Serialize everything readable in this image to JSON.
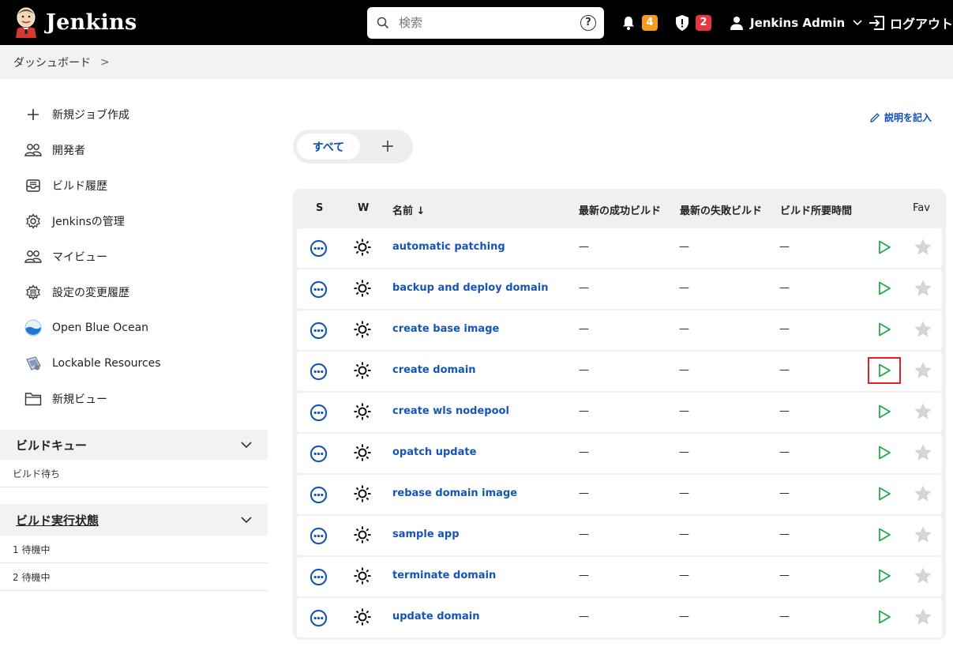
{
  "header": {
    "brand": "Jenkins",
    "search_placeholder": "検索",
    "help": "?",
    "notifications_count": "4",
    "security_count": "2",
    "user_name": "Jenkins Admin",
    "logout": "ログアウト"
  },
  "breadcrumb": {
    "dashboard": "ダッシュボード",
    "separator": ">"
  },
  "sidebar": {
    "items": [
      {
        "label": "新規ジョブ作成",
        "icon": "plus-icon"
      },
      {
        "label": "開発者",
        "icon": "people-icon"
      },
      {
        "label": "ビルド履歴",
        "icon": "inbox-icon"
      },
      {
        "label": "Jenkinsの管理",
        "icon": "gear-icon"
      },
      {
        "label": "マイビュー",
        "icon": "people-icon"
      },
      {
        "label": "設定の変更履歴",
        "icon": "config-history-icon"
      },
      {
        "label": "Open Blue Ocean",
        "icon": "blue-ocean-icon"
      },
      {
        "label": "Lockable Resources",
        "icon": "lock-resources-icon"
      },
      {
        "label": "新規ビュー",
        "icon": "folder-icon"
      }
    ],
    "build_queue": {
      "title": "ビルドキュー",
      "empty": "ビルド待ち"
    },
    "executors": {
      "title": "ビルド実行状態",
      "rows": [
        "1 待機中",
        "2 待機中"
      ]
    }
  },
  "main": {
    "add_description": "説明を記入",
    "tabs": {
      "all": "すべて",
      "add": "+"
    },
    "columns": {
      "s": "S",
      "w": "W",
      "name": "名前 ↓",
      "last_success": "最新の成功ビルド",
      "last_failure": "最新の失敗ビルド",
      "duration": "ビルド所要時間",
      "fav": "Fav"
    },
    "jobs": [
      {
        "name": "automatic patching",
        "last_success": "—",
        "last_failure": "—",
        "duration": "—"
      },
      {
        "name": "backup and deploy domain",
        "last_success": "—",
        "last_failure": "—",
        "duration": "—"
      },
      {
        "name": "create base image",
        "last_success": "—",
        "last_failure": "—",
        "duration": "—"
      },
      {
        "name": "create domain",
        "last_success": "—",
        "last_failure": "—",
        "duration": "—"
      },
      {
        "name": "create wls nodepool",
        "last_success": "—",
        "last_failure": "—",
        "duration": "—"
      },
      {
        "name": "opatch update",
        "last_success": "—",
        "last_failure": "—",
        "duration": "—"
      },
      {
        "name": "rebase domain image",
        "last_success": "—",
        "last_failure": "—",
        "duration": "—"
      },
      {
        "name": "sample app",
        "last_success": "—",
        "last_failure": "—",
        "duration": "—"
      },
      {
        "name": "terminate domain",
        "last_success": "—",
        "last_failure": "—",
        "duration": "—"
      },
      {
        "name": "update domain",
        "last_success": "—",
        "last_failure": "—",
        "duration": "—"
      }
    ]
  },
  "colors": {
    "accent": "#1655b5",
    "play": "#1ea64b",
    "badge_orange": "#f29d1b",
    "badge_red": "#e5373f",
    "highlight": "#e0202a"
  }
}
